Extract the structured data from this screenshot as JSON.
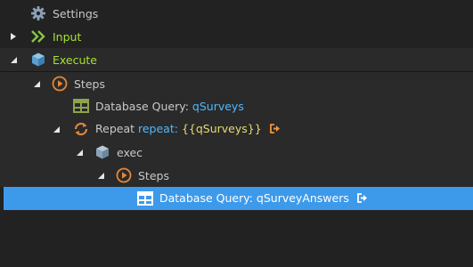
{
  "tree": {
    "settings": {
      "label": "Settings",
      "icon": "gear-icon"
    },
    "input": {
      "label": "Input",
      "icon": "double-chevron-icon"
    },
    "execute": {
      "label": "Execute",
      "icon": "cube-icon"
    },
    "steps_top": {
      "label": "Steps",
      "icon": "play-circle-icon"
    },
    "db_query_surveys": {
      "prefix": "Database Query:",
      "value": "qSurveys",
      "icon": "table-icon"
    },
    "repeat": {
      "prefix": "Repeat",
      "keyword": "repeat:",
      "expression": "{{qSurveys}}",
      "icon": "repeat-icon",
      "badge": "exit-icon"
    },
    "exec": {
      "label": "exec",
      "icon": "cube-icon"
    },
    "steps_inner": {
      "label": "Steps",
      "icon": "play-circle-icon"
    },
    "db_query_answers": {
      "prefix": "Database Query:",
      "value": "qSurveyAnswers",
      "icon": "table-icon",
      "badge": "exit-icon"
    }
  },
  "colors": {
    "background": "#222222",
    "band": "#2a2a2a",
    "selected": "#3d9aeb",
    "green": "#a6e22e",
    "blue": "#4fb8ff",
    "yellow": "#e6db74",
    "orange": "#f0943a",
    "cube": "#6aaed6"
  }
}
